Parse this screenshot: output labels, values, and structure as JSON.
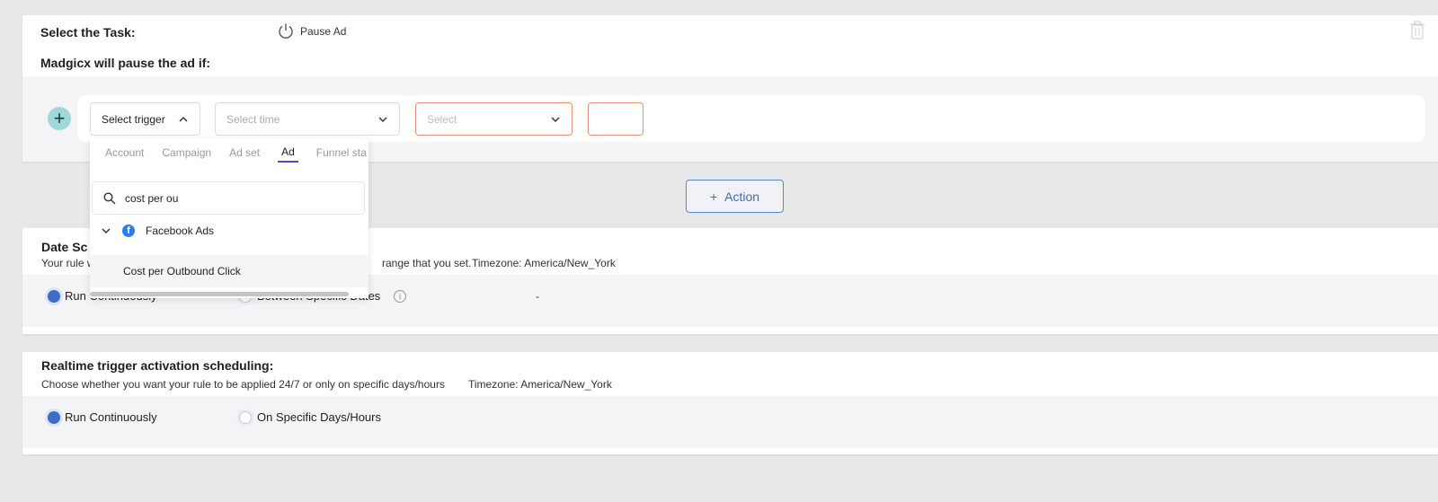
{
  "task": {
    "select_label": "Select the Task:",
    "pause_ad_label": "Pause Ad",
    "condition_label": "Madgicx will pause the ad if:"
  },
  "trigger_row": {
    "trigger_select": "Select trigger",
    "time_placeholder": "Select time",
    "operator_placeholder": "Select"
  },
  "action_button": {
    "label": "Action"
  },
  "dropdown": {
    "tabs": [
      "Account",
      "Campaign",
      "Ad set",
      "Ad",
      "Funnel sta"
    ],
    "active_tab": "Ad",
    "search_value": "cost per ou",
    "group_label": "Facebook Ads",
    "option_label": "Cost per Outbound Click"
  },
  "date_schedule": {
    "title_visible": "Date Sc",
    "desc_prefix": "Your rule w",
    "desc_suffix": "range that you set.",
    "timezone": "Timezone: America/New_York",
    "run_continuously": "Run Continuously",
    "between_dates": "Between Specific Dates",
    "dash": "-"
  },
  "realtime": {
    "title": "Realtime trigger activation scheduling:",
    "description": "Choose whether you want your rule to be applied 24/7 or only on specific days/hours",
    "timezone": "Timezone: America/New_York",
    "run_continuously": "Run Continuously",
    "specific_days": "On Specific Days/Hours"
  },
  "colors": {
    "accent_blue": "#3f6cc7",
    "error_border": "#e8926e",
    "add_circle": "#9fd8d8",
    "tab_underline": "#4a4bc7"
  }
}
